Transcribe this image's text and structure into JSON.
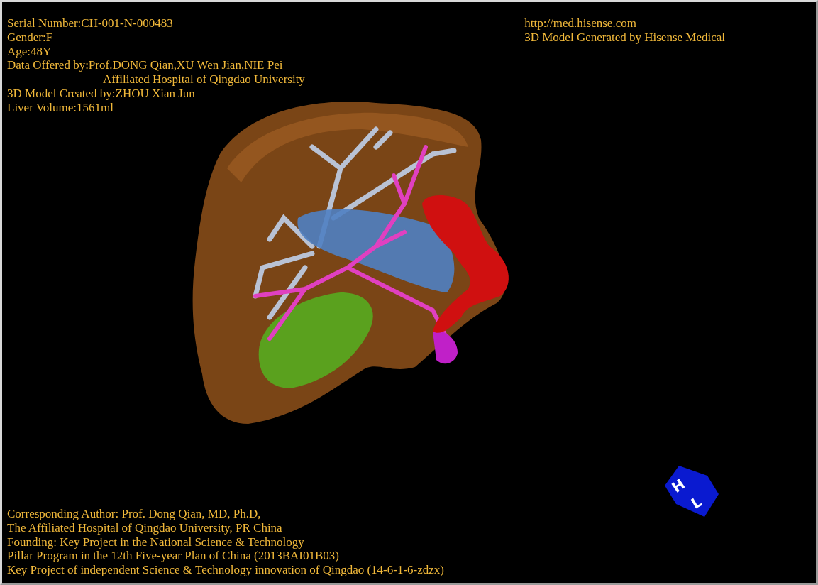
{
  "info_lines": [
    {
      "text": "Serial Number:CH-001-N-000483",
      "kind": "line"
    },
    {
      "text": "Gender:F",
      "kind": "line"
    },
    {
      "text": "Age:48Y",
      "kind": "line"
    },
    {
      "text": "Data Offered by:Prof.DONG Qian,XU Wen Jian,NIE Pei",
      "kind": "line"
    },
    {
      "text": "Affiliated Hospital of Qingdao University",
      "kind": "continuation"
    },
    {
      "text": "3D Model Created by:ZHOU Xian Jun",
      "kind": "line"
    },
    {
      "text": "Liver Volume:1561ml",
      "kind": "line"
    }
  ],
  "credit_lines": [
    "http://med.hisense.com",
    "3D Model Generated by Hisense Medical"
  ],
  "footer_lines": [
    "Corresponding Author: Prof. Dong Qian, MD, Ph.D,",
    "The Affiliated Hospital of Qingdao University, PR China",
    "Founding: Key Project in the National Science & Technology",
    "Pillar Program in the 12th Five-year Plan of China (2013BAI01B03)",
    "Key Project of independent Science & Technology innovation of Qingdao (14-6-1-6-zdzx)"
  ],
  "orientation_cube": {
    "labels": [
      "H",
      "L"
    ]
  }
}
